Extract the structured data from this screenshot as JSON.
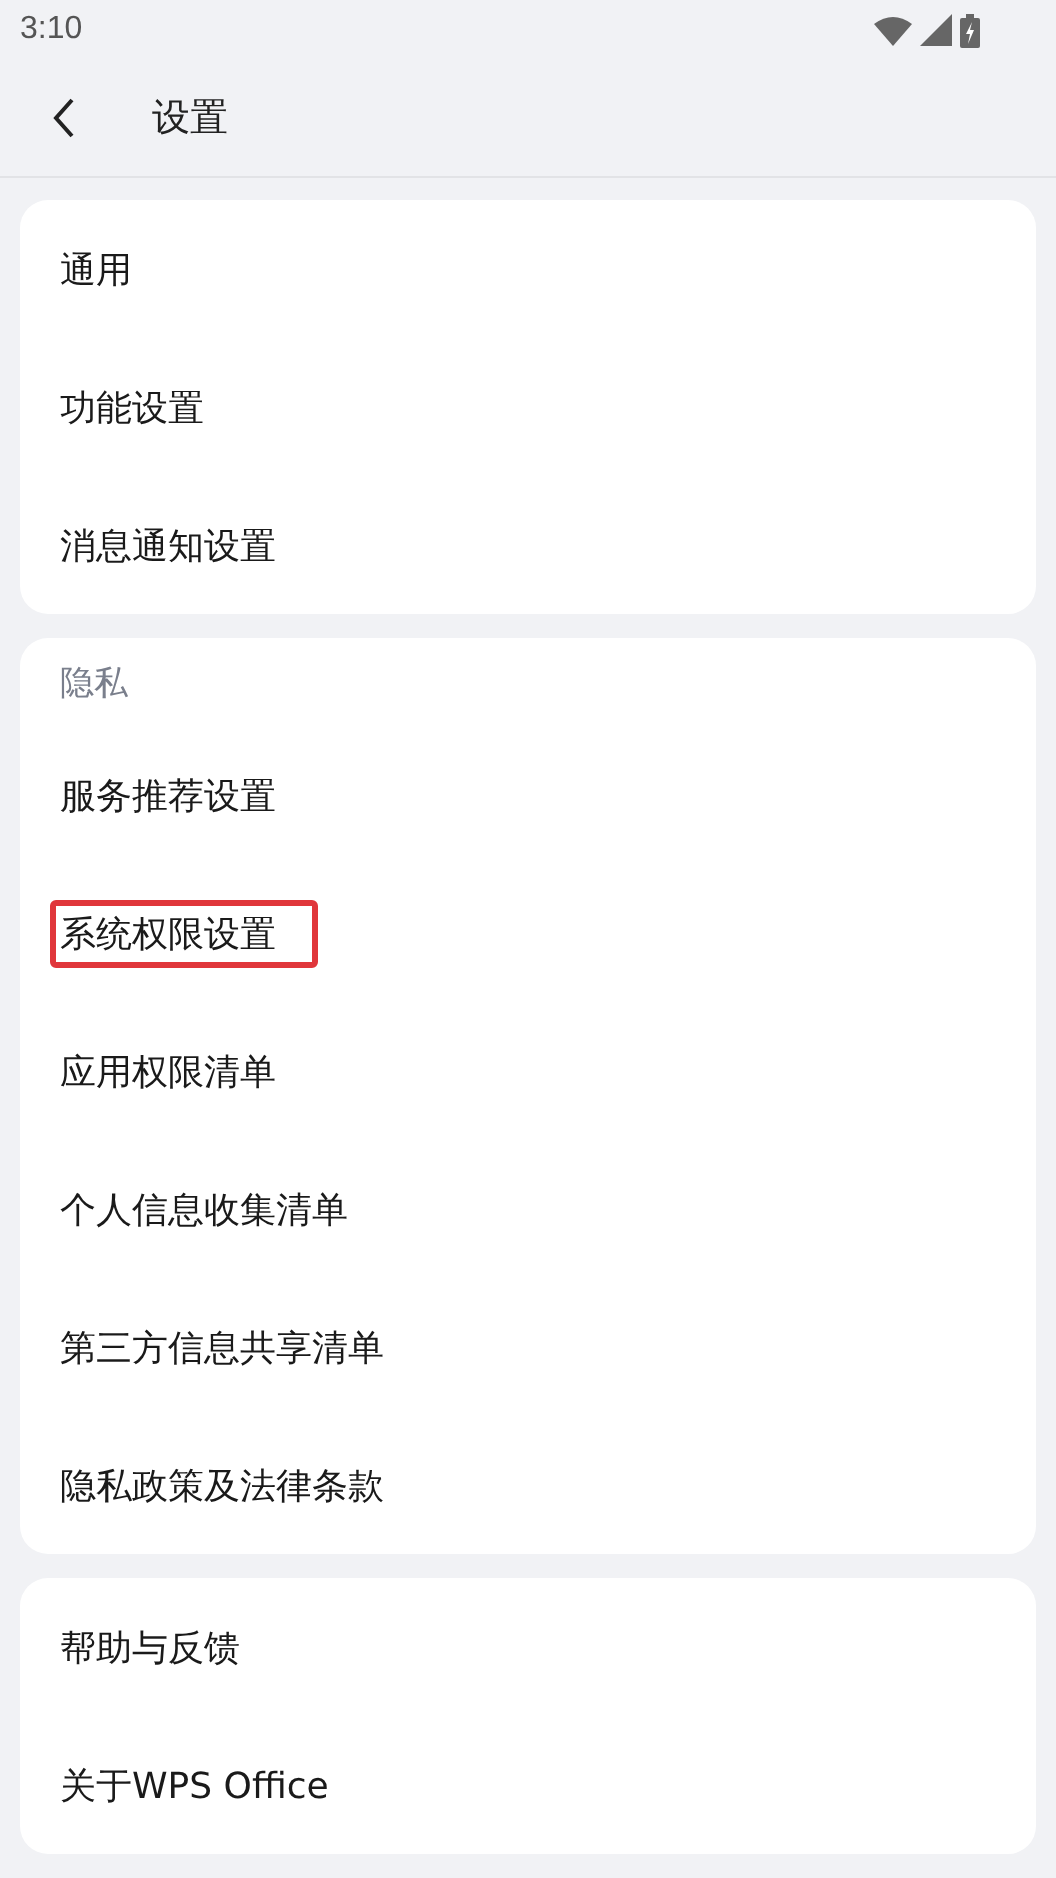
{
  "status_bar": {
    "time": "3:10"
  },
  "header": {
    "title": "设置"
  },
  "groups": [
    {
      "items": [
        {
          "label": "通用",
          "highlighted": false
        },
        {
          "label": "功能设置",
          "highlighted": false
        },
        {
          "label": "消息通知设置",
          "highlighted": false
        }
      ]
    },
    {
      "heading": "隐私",
      "items": [
        {
          "label": "服务推荐设置",
          "highlighted": false
        },
        {
          "label": "系统权限设置",
          "highlighted": true
        },
        {
          "label": "应用权限清单",
          "highlighted": false
        },
        {
          "label": "个人信息收集清单",
          "highlighted": false
        },
        {
          "label": "第三方信息共享清单",
          "highlighted": false
        },
        {
          "label": "隐私政策及法律条款",
          "highlighted": false
        }
      ]
    },
    {
      "items": [
        {
          "label": "帮助与反馈",
          "highlighted": false
        },
        {
          "label": "关于WPS Office",
          "highlighted": false
        }
      ]
    }
  ]
}
